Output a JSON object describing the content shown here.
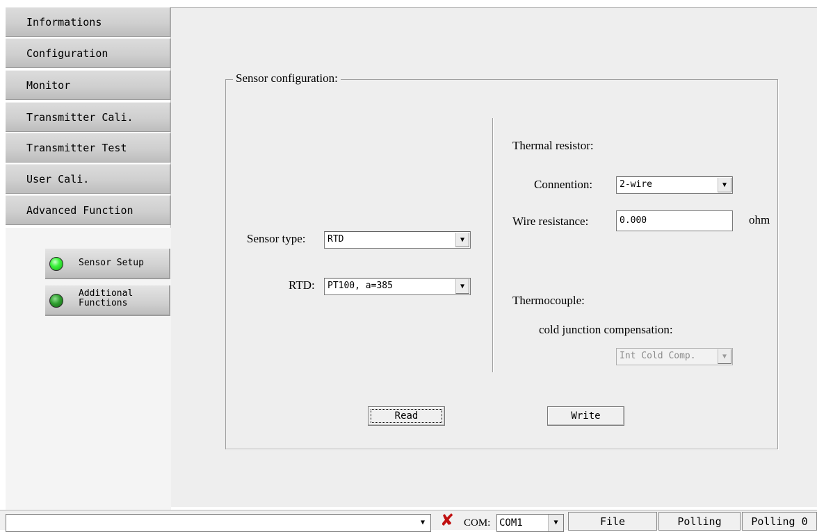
{
  "nav": {
    "items": [
      {
        "label": "Informations"
      },
      {
        "label": "Configuration"
      },
      {
        "label": "Monitor"
      },
      {
        "label": "Transmitter Cali."
      },
      {
        "label": "Transmitter Test"
      },
      {
        "label": "User Cali."
      },
      {
        "label": "Advanced Function"
      }
    ],
    "sub_items": [
      {
        "label": "Sensor Setup",
        "status": "active"
      },
      {
        "label": "Additional\nFunctions",
        "status": "inactive"
      }
    ]
  },
  "sensor_config": {
    "title": "Sensor configuration:",
    "sensor_type_label": "Sensor type:",
    "sensor_type_value": "RTD",
    "rtd_label": "RTD:",
    "rtd_value": "PT100,  a=385",
    "thermal_resistor_label": "Thermal resistor:",
    "connection_label": "Connention:",
    "connection_value": "2-wire",
    "wire_resistance_label": "Wire resistance:",
    "wire_resistance_value": "0.000",
    "wire_resistance_unit": "ohm",
    "thermocouple_label": "Thermocouple:",
    "cjc_label": "cold junction compensation:",
    "cjc_value": "Int Cold Comp.",
    "read_label": "Read",
    "write_label": "Write"
  },
  "statusbar": {
    "com_label": "COM:",
    "com_value": "COM1",
    "file_label": "File",
    "polling_label": "Polling",
    "polling_count": "Polling 0"
  },
  "colors": {
    "led_on": "#3cf23c",
    "led_off": "#2f9e2f",
    "disconnect_icon": "#c01010"
  }
}
